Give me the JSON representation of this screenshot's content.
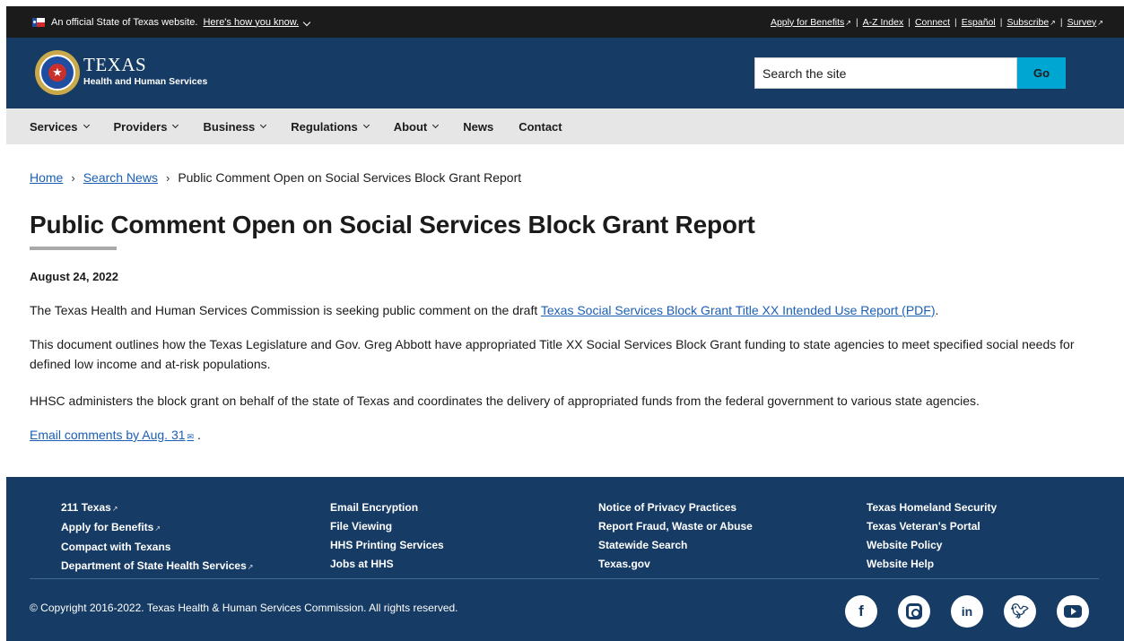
{
  "official_banner": {
    "text": "An official State of Texas website.",
    "link": "Here's how you know.",
    "utility_links": [
      {
        "label": "Apply for Benefits",
        "external": true
      },
      {
        "label": "A-Z Index",
        "external": false
      },
      {
        "label": "Connect",
        "external": false
      },
      {
        "label": "Español",
        "external": false
      },
      {
        "label": "Subscribe",
        "external": true
      },
      {
        "label": "Survey",
        "external": true
      }
    ]
  },
  "header": {
    "brand_line1": "TEXAS",
    "brand_line2": "Health and Human Services",
    "search_placeholder": "Search the site",
    "search_button": "Go"
  },
  "nav": {
    "items": [
      {
        "label": "Services",
        "dropdown": true
      },
      {
        "label": "Providers",
        "dropdown": true
      },
      {
        "label": "Business",
        "dropdown": true
      },
      {
        "label": "Regulations",
        "dropdown": true
      },
      {
        "label": "About",
        "dropdown": true
      },
      {
        "label": "News",
        "dropdown": false
      },
      {
        "label": "Contact",
        "dropdown": false
      }
    ]
  },
  "breadcrumb": {
    "home": "Home",
    "search_news": "Search News",
    "current": "Public Comment Open on Social Services Block Grant Report"
  },
  "article": {
    "title": "Public Comment Open on Social Services Block Grant Report",
    "date": "August 24, 2022",
    "p1_text": "The Texas Health and Human Services Commission is seeking public comment on the draft ",
    "p1_link": "Texas Social Services Block Grant Title XX Intended Use Report (PDF)",
    "p1_end": ".",
    "p2": "This document outlines how the Texas Legislature and Gov. Greg Abbott have appropriated Title XX Social Services Block Grant funding to state agencies to meet specified social needs for defined low income and at-risk populations.",
    "p3": "HHSC administers the block grant on behalf of the state of Texas and coordinates the delivery of appropriated funds from the federal government to various state agencies.",
    "p4_link": "Email comments by Aug. 31",
    "p4_end": "."
  },
  "footer": {
    "col1": [
      "211 Texas",
      "Apply for Benefits",
      "Compact with Texans",
      "Department of State Health Services"
    ],
    "col2": [
      "Email Encryption",
      "File Viewing",
      "HHS Printing Services",
      "Jobs at HHS"
    ],
    "col3": [
      "Notice of Privacy Practices",
      "Report Fraud, Waste or Abuse",
      "Statewide Search",
      "Texas.gov"
    ],
    "col4": [
      "Texas Homeland Security",
      "Texas Veteran's Portal",
      "Website Policy",
      "Website Help"
    ],
    "copyright": "© Copyright 2016-2022. Texas Health & Human Services Commission. All rights reserved.",
    "socials": [
      "facebook-icon",
      "instagram-icon",
      "linkedin-icon",
      "twitter-icon",
      "youtube-icon"
    ]
  },
  "colors": {
    "header_bg": "#163b64",
    "banner_bg": "#1b1b1b",
    "nav_bg": "#e6e6e6",
    "link": "#1a5fb4",
    "go_button": "#00a6d2"
  }
}
